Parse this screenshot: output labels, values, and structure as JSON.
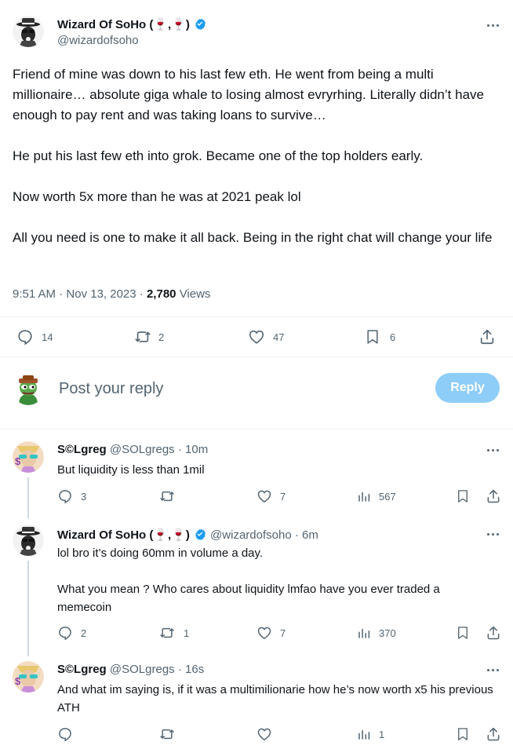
{
  "tweet": {
    "author_name": "Wizard Of SoHo (🍷,🍷)",
    "author_handle": "@wizardofsoho",
    "paragraphs": [
      "Friend of mine was down to his last few eth. He went from being a multi millionaire… absolute giga whale to losing almost evryrhing. Literally didn’t have enough to pay rent and was taking loans to survive…",
      "He put his last few eth into grok. Became one of the top holders early.",
      "Now worth 5x more than he was at 2021 peak lol",
      "All you need is one to make it all back. Being in the right chat will change your life"
    ],
    "time": "9:51 AM",
    "date": "Nov 13, 2023",
    "separator": "·",
    "views_count": "2,780",
    "views_label": "Views",
    "actions": {
      "replies": "14",
      "reposts": "2",
      "likes": "47",
      "bookmarks": "6"
    }
  },
  "composer": {
    "placeholder": "Post your reply",
    "button_label": "Reply",
    "button_color": "#8ecdf8"
  },
  "replies": [
    {
      "name": "S©Lgreg",
      "handle": "@SOLgregs",
      "sep": "·",
      "age": "10m",
      "paragraphs": [
        "But liquidity is less than 1mil"
      ],
      "replies": "3",
      "reposts": "",
      "likes": "7",
      "views": "567"
    },
    {
      "name": "Wizard Of SoHo (🍷,🍷)",
      "handle": "@wizardofsoho",
      "sep": "·",
      "age": "6m",
      "paragraphs": [
        "lol bro it’s doing 60mm in volume a day.",
        "What you mean ? Who cares about liquidity lmfao have you ever traded a memecoin"
      ],
      "replies": "2",
      "reposts": "1",
      "likes": "7",
      "views": "370"
    },
    {
      "name": "S©Lgreg",
      "handle": "@SOLgregs",
      "sep": "·",
      "age": "16s",
      "paragraphs": [
        "And what im saying is, if it was a multimilionarie how he’s now worth x5 his previous ATH"
      ],
      "replies": "",
      "reposts": "",
      "likes": "",
      "views": "1"
    }
  ],
  "colors": {
    "verified": "#1d9bf0",
    "secondary_text": "#536471",
    "divider": "#eff3f4",
    "thread_line": "#cfd9de"
  }
}
